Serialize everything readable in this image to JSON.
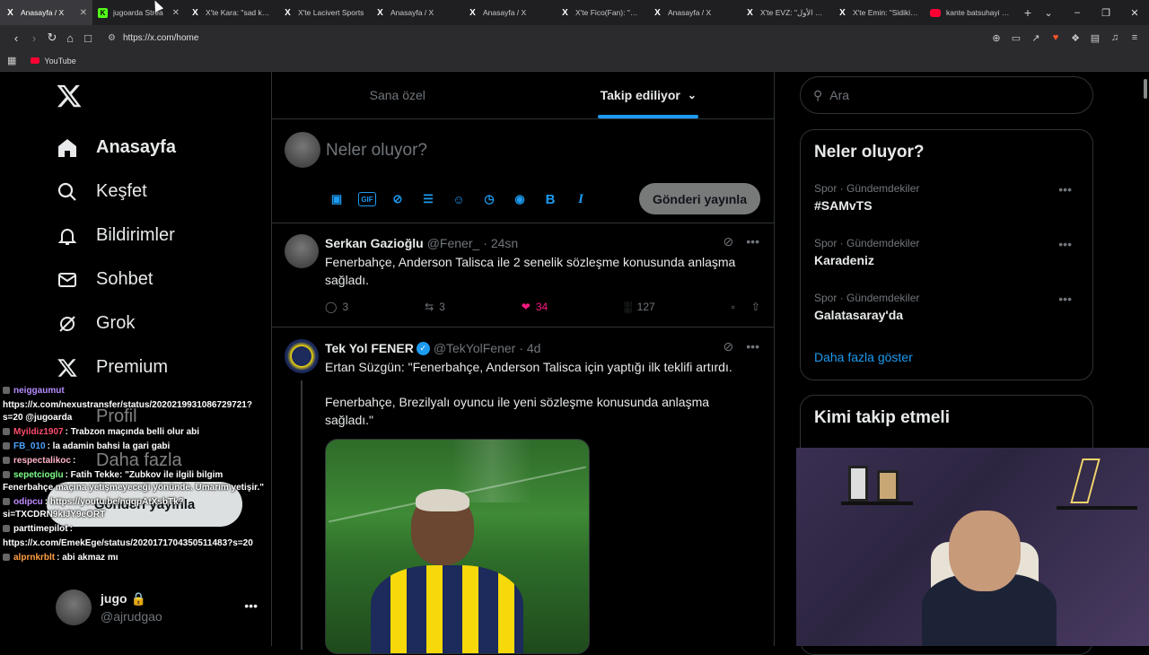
{
  "browser": {
    "tabs": [
      {
        "title": "Anasayfa / X",
        "icon": "x-logo",
        "active": true
      },
      {
        "title": "jugoarda Strea",
        "icon": "kick-logo",
        "active": false
      },
      {
        "title": "X'te Kara: \"sad kara",
        "icon": "x-logo",
        "active": false
      },
      {
        "title": "X'te Lacivert Sports",
        "icon": "x-logo",
        "active": false
      },
      {
        "title": "Anasayfa / X",
        "icon": "x-logo",
        "active": false
      },
      {
        "title": "Anasayfa / X",
        "icon": "x-logo",
        "active": false
      },
      {
        "title": "X'te Fico(Fan): \"1. K",
        "icon": "x-logo",
        "active": false
      },
      {
        "title": "Anasayfa / X",
        "icon": "x-logo",
        "active": false
      },
      {
        "title": "X'te EVZ: \"ـوط الأول",
        "icon": "x-logo",
        "active": false
      },
      {
        "title": "X'te Emin: \"Sidiki Ch",
        "icon": "x-logo",
        "active": false
      },
      {
        "title": "kante batsuhayi - Yo",
        "icon": "youtube-logo",
        "active": false
      }
    ],
    "url": "https://x.com/home",
    "bookmark": "YouTube"
  },
  "nav": {
    "items": [
      {
        "label": "Anasayfa",
        "icon": "home-icon",
        "bold": true
      },
      {
        "label": "Keşfet",
        "icon": "search-icon"
      },
      {
        "label": "Bildirimler",
        "icon": "bell-icon"
      },
      {
        "label": "Sohbet",
        "icon": "mail-icon"
      },
      {
        "label": "Grok",
        "icon": "grok-icon"
      },
      {
        "label": "Premium",
        "icon": "x-premium-icon"
      }
    ],
    "hidden_items": [
      "Profil",
      "Daha fazla"
    ],
    "post_button": "Gönderi yayınla",
    "account": {
      "name": "jugo",
      "handle": "@ajrudgao"
    }
  },
  "feed": {
    "tabs": [
      "Sana özel",
      "Takip ediliyor"
    ],
    "compose_placeholder": "Neler oluyor?",
    "compose_post": "Gönderi yayınla",
    "tweets": [
      {
        "name": "Serkan Gazioğlu",
        "handle": "@Fener_",
        "time": "· 24sn",
        "text": "Fenerbahçe, Anderson Talisca ile 2 senelik sözleşme konusunda anlaşma sağladı.",
        "replies": "3",
        "reposts": "3",
        "likes": "34",
        "views": "127"
      },
      {
        "name": "Tek Yol FENER",
        "handle": "@TekYolFener",
        "time": "· 4d",
        "verified": true,
        "text": "Ertan Süzgün: \"Fenerbahçe, Anderson Talisca için yaptığı ilk teklifi artırdı.\n\nFenerbahçe, Brezilyalı oyuncu ile yeni sözleşme konusunda anlaşma sağladı.\""
      }
    ]
  },
  "sidebar": {
    "search_placeholder": "Ara",
    "trending_title": "Neler oluyor?",
    "trends": [
      {
        "meta": "Spor · Gündemdekiler",
        "title": "#SAMvTS"
      },
      {
        "meta": "Spor · Gündemdekiler",
        "title": "Karadeniz"
      },
      {
        "meta": "Spor · Gündemdekiler",
        "title": "Galatasaray'da"
      }
    ],
    "show_more": "Daha fazla göster",
    "who_to_follow": "Kimi takip etmeli"
  },
  "chat": [
    {
      "user": "neiggaumut",
      "text": "",
      "color": "#b58cff"
    },
    {
      "user": "",
      "text": "https://x.com/nexustransfer/status/2020219931086729721?s=20 @jugoarda",
      "color": "#ffffff"
    },
    {
      "user": "Myildiz1907",
      "text": ": Trabzon maçında belli olur abi",
      "color": "#ff4d6d"
    },
    {
      "user": "FB_010",
      "text": ": la adamin bahsi la gari gabi",
      "color": "#4da3ff"
    },
    {
      "user": "respectalikoc",
      "text": ":",
      "color": "#ffb3c7"
    },
    {
      "user": "sepetcioglu",
      "text": ": Fatih Tekke: \"Zubkov ile ilgili bilgim Fenerbahçe maçına yetişmeyeceği yönünde. Umarım yetişir.\"",
      "color": "#7dff8a"
    },
    {
      "user": "odipcu",
      "text": ": https://youtu.be/nqqpAtXsbTk?si=TXCDRN9kIJY9eORT",
      "color": "#c18cff"
    },
    {
      "user": "parttimepilot",
      "text": ":",
      "color": "#ffffff"
    },
    {
      "user": "",
      "text": "https://x.com/EmekEge/status/2020171704350511483?s=20",
      "color": "#ffffff"
    },
    {
      "user": "alprnkrblt",
      "text": ": abi akmaz mı",
      "color": "#ff9f43"
    }
  ],
  "colors": {
    "accent": "#1d9bf0",
    "like": "#f91880",
    "bg": "#000000"
  }
}
